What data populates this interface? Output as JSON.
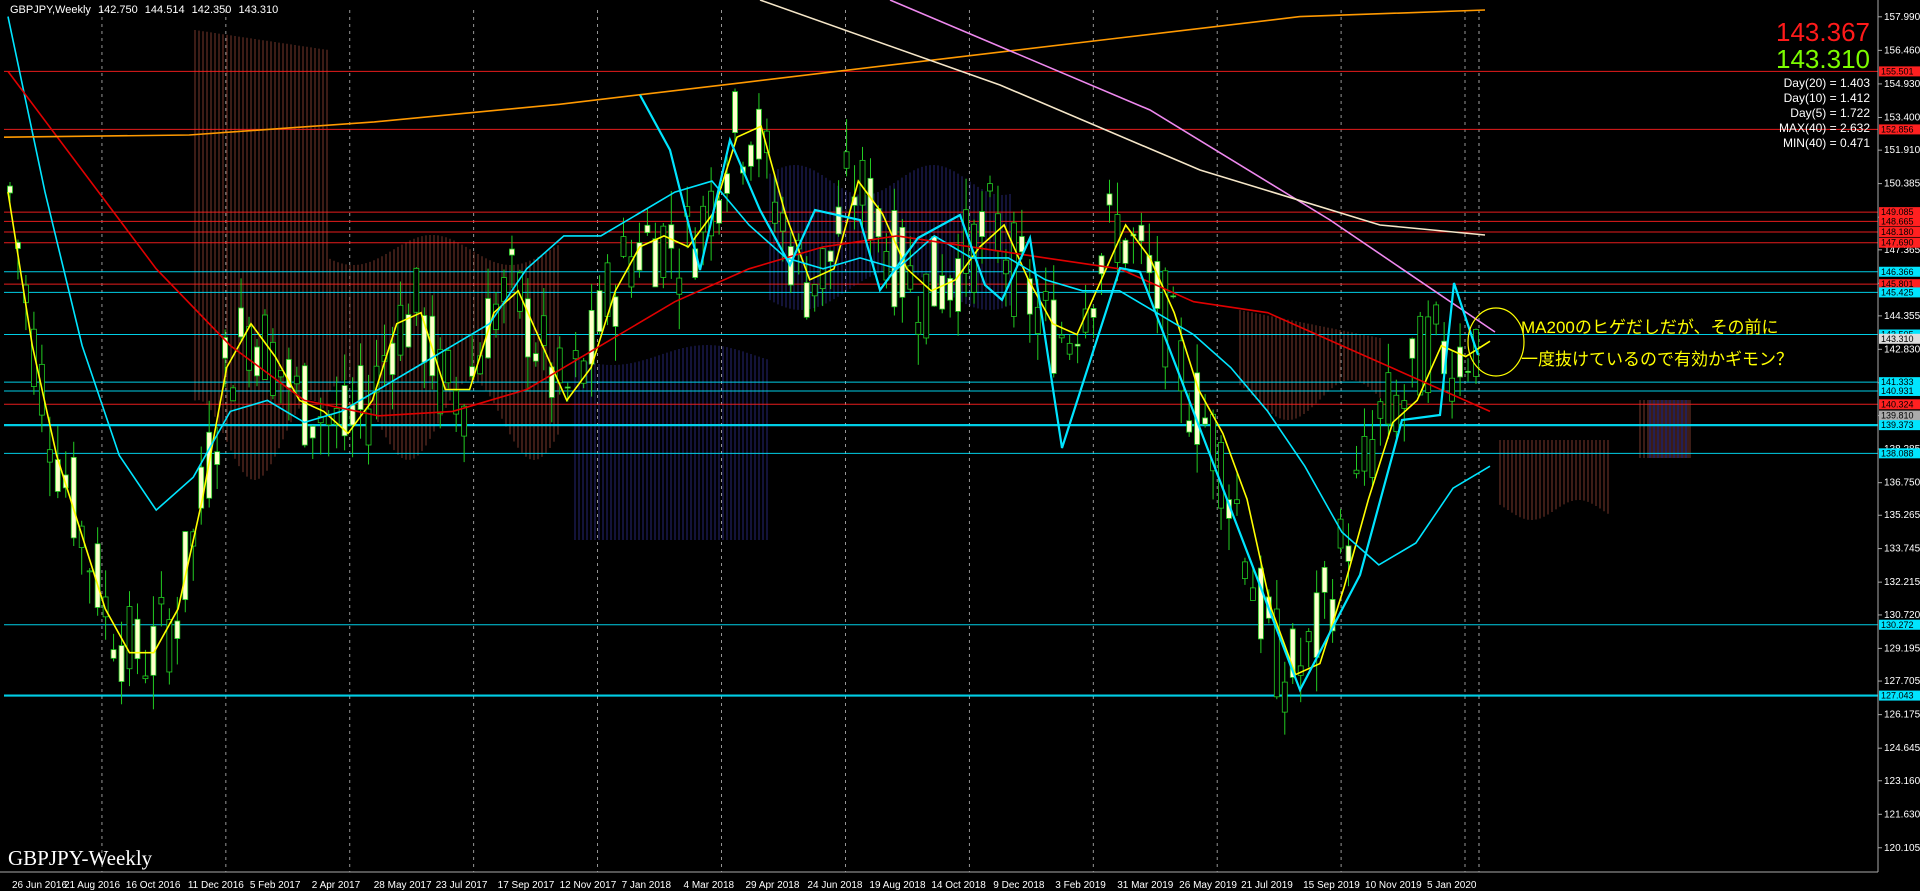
{
  "header": {
    "symbol": "GBPJPY,Weekly",
    "ohlc": [
      "142.750",
      "144.514",
      "142.350",
      "143.310"
    ]
  },
  "watermark": "GBPJPY-Weekly",
  "prices": {
    "ask": "143.367",
    "bid": "143.310",
    "ask_color": "#ff1a1a",
    "bid_color": "#7CFC00"
  },
  "stats": [
    "Day(20) = 1.403",
    "Day(10) = 1.412",
    "Day(5) = 1.722",
    "MAX(40) = 2.632",
    "MIN(40) = 0.471"
  ],
  "annotation": {
    "line1": "MA200のヒゲだしだが、その前に",
    "line2": "一度抜けているので有効かギモン？",
    "color": "#ffff00"
  },
  "chart_data": {
    "type": "line",
    "title": "",
    "ylim": [
      119.0,
      158.3
    ],
    "y_ticks": [
      "157.990",
      "156.460",
      "154.930",
      "153.400",
      "151.910",
      "150.385",
      "148.855",
      "147.365",
      "145.840",
      "144.355",
      "142.830",
      "141.305",
      "139.810",
      "138.285",
      "136.750",
      "135.265",
      "133.745",
      "132.215",
      "130.720",
      "129.195",
      "127.705",
      "126.175",
      "124.645",
      "123.160",
      "121.630",
      "120.105"
    ],
    "x_labels": [
      "26 Jun 2016",
      "21 Aug 2016",
      "16 Oct 2016",
      "11 Dec 2016",
      "5 Feb 2017",
      "2 Apr 2017",
      "28 May 2017",
      "23 Jul 2017",
      "17 Sep 2017",
      "12 Nov 2017",
      "7 Jan 2018",
      "4 Mar 2018",
      "29 Apr 2018",
      "24 Jun 2018",
      "19 Aug 2018",
      "14 Oct 2018",
      "9 Dec 2018",
      "3 Feb 2019",
      "31 Mar 2019",
      "26 May 2019",
      "21 Jul 2019",
      "15 Sep 2019",
      "10 Nov 2019",
      "5 Jan 2020"
    ],
    "level_tags": [
      {
        "value": 155.501,
        "label": "155.501",
        "color": "#ff2020"
      },
      {
        "value": 152.856,
        "label": "152.856",
        "color": "#ff2020"
      },
      {
        "value": 149.085,
        "label": "149.085",
        "color": "#ff2020"
      },
      {
        "value": 148.665,
        "label": "148.665",
        "color": "#ff2020"
      },
      {
        "value": 148.18,
        "label": "148.180",
        "color": "#ff2020"
      },
      {
        "value": 147.69,
        "label": "147.690",
        "color": "#ff2020"
      },
      {
        "value": 146.366,
        "label": "146.366",
        "color": "#00e5ff"
      },
      {
        "value": 145.801,
        "label": "145.801",
        "color": "#ff2020"
      },
      {
        "value": 145.425,
        "label": "145.425",
        "color": "#00e5ff"
      },
      {
        "value": 143.505,
        "label": "143.505",
        "color": "#00e5ff"
      },
      {
        "value": 143.31,
        "label": "143.310",
        "color": "#dddddd"
      },
      {
        "value": 141.333,
        "label": "141.333",
        "color": "#00e5ff"
      },
      {
        "value": 140.931,
        "label": "140.931",
        "color": "#00e5ff"
      },
      {
        "value": 140.324,
        "label": "140.324",
        "color": "#ff2020"
      },
      {
        "value": 139.81,
        "label": "139.810",
        "color": "#aaaaaa"
      },
      {
        "value": 139.373,
        "label": "139.373",
        "color": "#00e5ff"
      },
      {
        "value": 138.088,
        "label": "138.088",
        "color": "#00e5ff"
      },
      {
        "value": 130.272,
        "label": "130.272",
        "color": "#00e5ff"
      },
      {
        "value": 127.043,
        "label": "127.043",
        "color": "#00e5ff"
      }
    ],
    "series": [
      {
        "name": "",
        "color": "#ffff00",
        "values": [
          150.0,
          143.0,
          138.0,
          134.5,
          131.0,
          129.0,
          129.0,
          131.0,
          136.0,
          142.0,
          144.0,
          142.5,
          140.5,
          140.0,
          139.0,
          140.5,
          144.0,
          144.5,
          141.0,
          141.0,
          144.5,
          145.5,
          143.0,
          140.5,
          142.0,
          145.5,
          147.5,
          148.0,
          147.5,
          149.0,
          152.5,
          153.0,
          149.0,
          146.0,
          146.5,
          150.5,
          149.0,
          146.5,
          145.5,
          146.0,
          147.5,
          148.5,
          146.0,
          144.0,
          143.5,
          146.0,
          148.5,
          147.0,
          144.5,
          141.0,
          139.0,
          136.0,
          131.0,
          128.0,
          128.5,
          132.0,
          136.0,
          139.5,
          140.5,
          143.0,
          142.5,
          143.2
        ]
      },
      {
        "name": "",
        "color": "#00e5ff",
        "values": [
          158.0,
          150.0,
          143.0,
          138.0,
          135.5,
          137.0,
          140.0,
          140.5,
          139.5,
          140.0,
          141.0,
          142.0,
          143.0,
          144.0,
          146.5,
          148.0,
          148.0,
          149.0,
          150.0,
          150.5,
          148.5,
          147.0,
          146.5,
          147.0,
          146.5,
          148.0,
          147.0,
          147.0,
          146.0,
          145.5,
          145.5,
          144.5,
          143.5,
          142.0,
          140.0,
          137.5,
          134.5,
          133.0,
          134.0,
          136.5,
          137.5
        ]
      },
      {
        "name": "",
        "color": "#e00000",
        "values": [
          155.5,
          151.0,
          146.5,
          143.0,
          140.5,
          139.8,
          140.0,
          141.0,
          143.0,
          145.0,
          146.5,
          147.5,
          148.0,
          147.5,
          147.0,
          146.5,
          145.0,
          144.5,
          143.0,
          141.5,
          140.0
        ]
      },
      {
        "name": "",
        "color": "#ff9900",
        "values": [
          152.5,
          152.6,
          153.2,
          154.0,
          155.0,
          156.0,
          157.0,
          158.0,
          158.3
        ]
      }
    ],
    "legend": "none",
    "grid": "vertical dashed"
  }
}
